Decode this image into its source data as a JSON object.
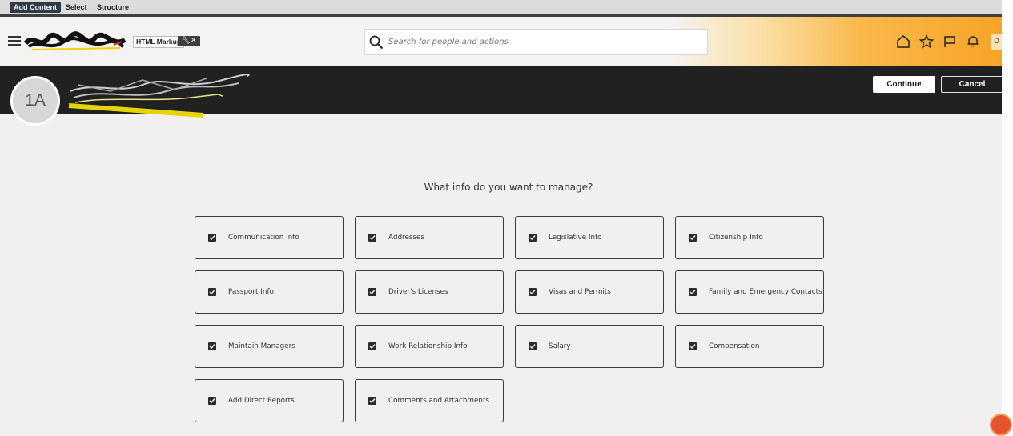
{
  "editor_bar": {
    "tabs": [
      "Add Content",
      "Select",
      "Structure"
    ]
  },
  "header": {
    "markup_label": "HTML Markup",
    "markup_tools_icons": [
      "wrench-icon",
      "close-icon"
    ],
    "search_placeholder": "Search for people and actions",
    "icons": [
      "home-icon",
      "star-icon",
      "flag-icon",
      "bell-icon"
    ],
    "user_initial": "D"
  },
  "banner": {
    "avatar_initials": "1A",
    "continue_label": "Continue",
    "cancel_label": "Cancel"
  },
  "main": {
    "question": "What info do you want to manage?",
    "options": [
      {
        "label": "Communication Info",
        "checked": true
      },
      {
        "label": "Addresses",
        "checked": true
      },
      {
        "label": "Legislative Info",
        "checked": true
      },
      {
        "label": "Citizenship Info",
        "checked": true
      },
      {
        "label": "Passport Info",
        "checked": true
      },
      {
        "label": "Driver's Licenses",
        "checked": true
      },
      {
        "label": "Visas and Permits",
        "checked": true
      },
      {
        "label": "Family and Emergency Contacts",
        "checked": true
      },
      {
        "label": "Maintain Managers",
        "checked": true
      },
      {
        "label": "Work Relationship Info",
        "checked": true
      },
      {
        "label": "Salary",
        "checked": true
      },
      {
        "label": "Compensation",
        "checked": true
      },
      {
        "label": "Add Direct Reports",
        "checked": true
      },
      {
        "label": "Comments and Attachments",
        "checked": true
      }
    ]
  },
  "colors": {
    "banner_bg": "#212121",
    "header_gradient_end": "#f8a425",
    "page_bg": "#f1f0ee"
  }
}
